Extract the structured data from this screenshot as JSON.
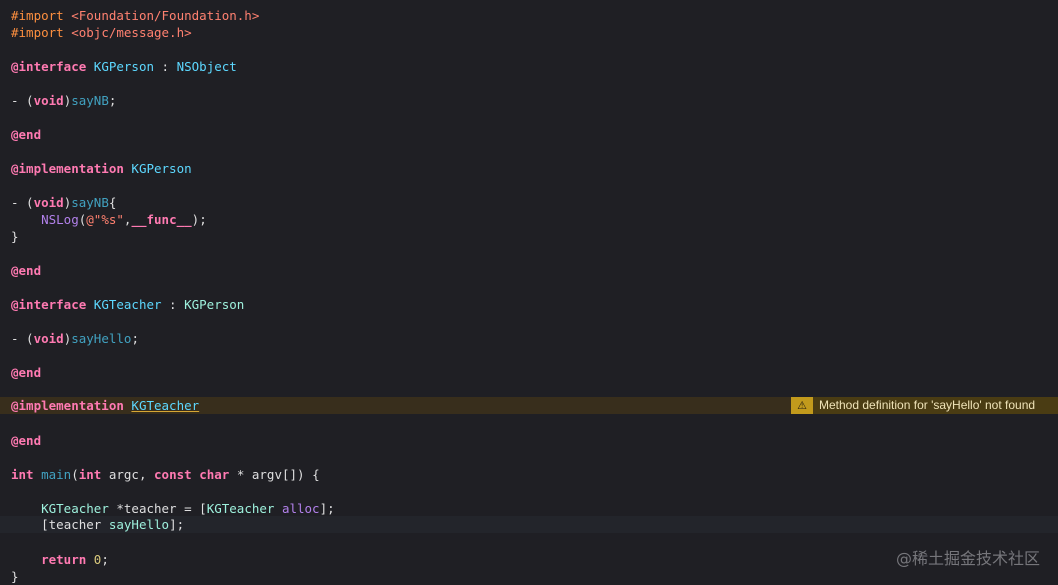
{
  "code": {
    "import1_kw": "#import",
    "import1_path": "<Foundation/Foundation.h>",
    "import2_kw": "#import",
    "import2_path": "<objc/message.h>",
    "interface_kw": "@interface",
    "person_class": "KGPerson",
    "colon": " : ",
    "nsobject": "NSObject",
    "dash": "- (",
    "void": "void",
    "close_paren": ")",
    "say_nb": "sayNB",
    "semicolon": ";",
    "end_kw": "@end",
    "implementation_kw": "@implementation",
    "brace_open": "{",
    "brace_close": "}",
    "indent": "    ",
    "nslog": "NSLog",
    "paren_open": "(",
    "format_str": "@\"%s\"",
    "comma": ",",
    "func_macro": "__func__",
    "paren_close_semi": ");",
    "teacher_class": "KGTeacher",
    "person_super": "KGPerson",
    "say_hello": "sayHello",
    "int_kw": "int",
    "main_fn": "main",
    "main_args_1": "(",
    "argc": " argc, ",
    "const_kw": "const",
    "char_kw": "char",
    "argv": " * argv[]) {",
    "space": " ",
    "teacher_decl_rest": " *teacher = [",
    "alloc": "alloc",
    "bracket_close_semi": "];",
    "bracket_open": "[",
    "teacher_var": "teacher ",
    "return_kw": "return",
    "zero": "0"
  },
  "warning": {
    "icon": "warning-triangle-icon",
    "message": "Method definition for 'sayHello' not found"
  },
  "watermark": "@稀土掘金技术社区"
}
